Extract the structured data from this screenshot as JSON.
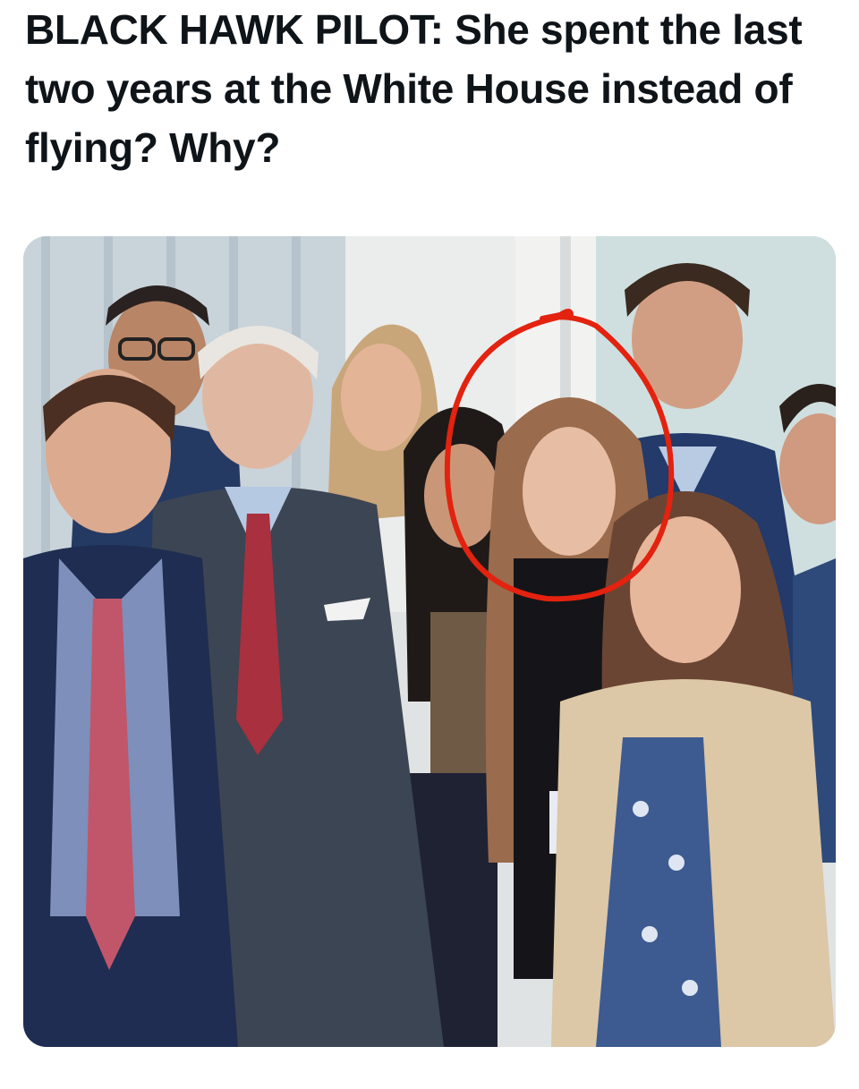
{
  "post": {
    "headline": "BLACK HAWK PILOT: She spent the last two years at the White House instead of flying? Why?"
  },
  "media": {
    "type": "photo",
    "highlight_color": "#e3220f"
  },
  "colors": {
    "text": "#0f1419",
    "background": "#ffffff"
  }
}
